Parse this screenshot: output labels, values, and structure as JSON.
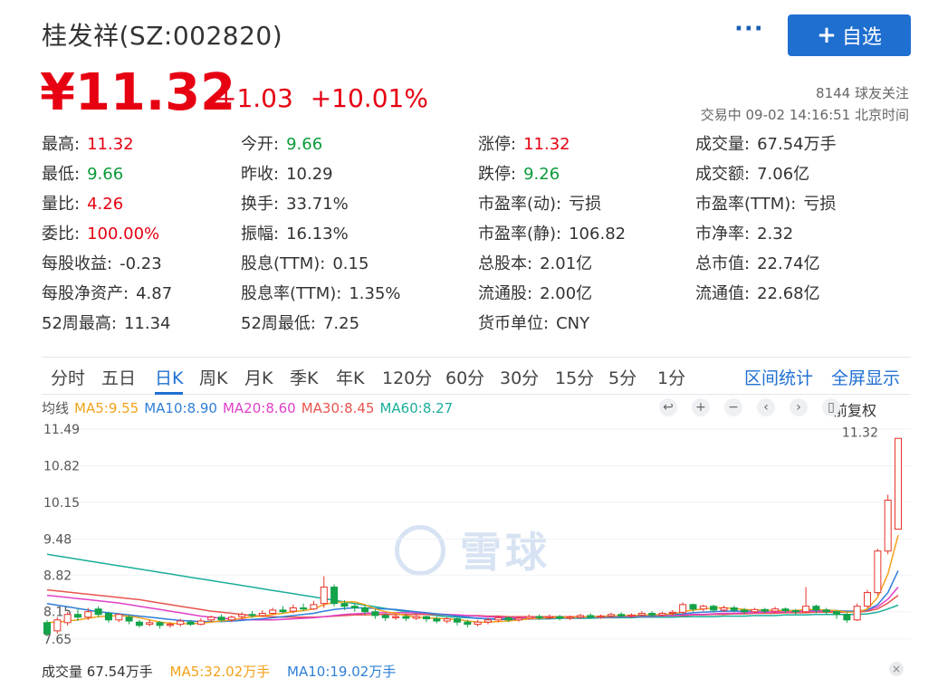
{
  "header": {
    "title": "桂发祥(SZ:002820)",
    "more_label": "···",
    "add_label": "自选",
    "add_plus": "+"
  },
  "quote": {
    "price": "¥11.32",
    "change": "+1.03",
    "change_pct": "+10.01%",
    "followers": "8144 球友关注",
    "trade_time": "交易中 09-02 14:16:51 北京时间"
  },
  "stats": [
    {
      "label": "最高:",
      "value": "11.32",
      "color": "red"
    },
    {
      "label": "今开:",
      "value": "9.66",
      "color": "green"
    },
    {
      "label": "涨停:",
      "value": "11.32",
      "color": "red"
    },
    {
      "label": "成交量:",
      "value": "67.54万手",
      "color": ""
    },
    {
      "label": "最低:",
      "value": "9.66",
      "color": "green"
    },
    {
      "label": "昨收:",
      "value": "10.29",
      "color": ""
    },
    {
      "label": "跌停:",
      "value": "9.26",
      "color": "green"
    },
    {
      "label": "成交额:",
      "value": "7.06亿",
      "color": ""
    },
    {
      "label": "量比:",
      "value": "4.26",
      "color": "red"
    },
    {
      "label": "换手:",
      "value": "33.71%",
      "color": ""
    },
    {
      "label": "市盈率(动):",
      "value": "亏损",
      "color": ""
    },
    {
      "label": "市盈率(TTM):",
      "value": "亏损",
      "color": ""
    },
    {
      "label": "委比:",
      "value": "100.00%",
      "color": "red"
    },
    {
      "label": "振幅:",
      "value": "16.13%",
      "color": ""
    },
    {
      "label": "市盈率(静):",
      "value": "106.82",
      "color": ""
    },
    {
      "label": "市净率:",
      "value": "2.32",
      "color": ""
    },
    {
      "label": "每股收益:",
      "value": "-0.23",
      "color": ""
    },
    {
      "label": "股息(TTM):",
      "value": "0.15",
      "color": ""
    },
    {
      "label": "总股本:",
      "value": "2.01亿",
      "color": ""
    },
    {
      "label": "总市值:",
      "value": "22.74亿",
      "color": ""
    },
    {
      "label": "每股净资产:",
      "value": "4.87",
      "color": ""
    },
    {
      "label": "股息率(TTM):",
      "value": "1.35%",
      "color": ""
    },
    {
      "label": "流通股:",
      "value": "2.00亿",
      "color": ""
    },
    {
      "label": "流通值:",
      "value": "22.68亿",
      "color": ""
    },
    {
      "label": "52周最高:",
      "value": "11.34",
      "color": ""
    },
    {
      "label": "52周最低:",
      "value": "7.25",
      "color": ""
    },
    {
      "label": "货币单位:",
      "value": "CNY",
      "color": ""
    }
  ],
  "tabs": [
    "分时",
    "五日",
    "日K",
    "周K",
    "月K",
    "季K",
    "年K",
    "120分",
    "60分",
    "30分",
    "15分",
    "5分",
    "1分"
  ],
  "active_tab": "日K",
  "tab_links": [
    "区间统计",
    "全屏显示"
  ],
  "ma": {
    "label": "均线",
    "items": [
      {
        "text": "MA5:9.55",
        "color": "#f2a21b"
      },
      {
        "text": "MA10:8.90",
        "color": "#2f7fd8"
      },
      {
        "text": "MA20:8.60",
        "color": "#e040c8"
      },
      {
        "text": "MA30:8.45",
        "color": "#e8544e"
      },
      {
        "text": "MA60:8.27",
        "color": "#1aae9a"
      }
    ]
  },
  "controls": {
    "buttons": [
      "↩",
      "+",
      "−",
      "‹",
      "›",
      "▯"
    ],
    "adjust_label": "前复权"
  },
  "chart_data": {
    "type": "candlestick",
    "y_ticks": [
      "11.49",
      "10.82",
      "10.15",
      "9.48",
      "8.82",
      "8.15",
      "7.65"
    ],
    "ylim": [
      7.45,
      11.49
    ],
    "last_price_label": "11.32",
    "candles": [
      [
        7.95,
        7.75,
        8.0,
        7.7
      ],
      [
        7.8,
        8.0,
        8.05,
        7.75
      ],
      [
        7.95,
        8.1,
        8.15,
        7.9
      ],
      [
        8.1,
        8.05,
        8.2,
        7.98
      ],
      [
        8.05,
        8.15,
        8.22,
        8.0
      ],
      [
        8.2,
        8.1,
        8.25,
        8.05
      ],
      [
        8.12,
        8.0,
        8.15,
        7.95
      ],
      [
        8.0,
        8.1,
        8.12,
        7.96
      ],
      [
        8.05,
        7.98,
        8.08,
        7.92
      ],
      [
        7.96,
        7.9,
        8.0,
        7.86
      ],
      [
        7.92,
        7.95,
        8.0,
        7.88
      ],
      [
        7.95,
        7.9,
        7.98,
        7.84
      ],
      [
        7.9,
        7.92,
        7.96,
        7.86
      ],
      [
        7.92,
        7.98,
        8.02,
        7.88
      ],
      [
        7.96,
        7.92,
        8.0,
        7.89
      ],
      [
        7.92,
        7.98,
        8.03,
        7.9
      ],
      [
        8.0,
        8.05,
        8.08,
        7.96
      ],
      [
        8.05,
        8.0,
        8.1,
        7.97
      ],
      [
        8.0,
        8.05,
        8.08,
        7.96
      ],
      [
        8.06,
        8.1,
        8.14,
        8.02
      ],
      [
        8.1,
        8.08,
        8.16,
        8.04
      ],
      [
        8.08,
        8.12,
        8.18,
        8.05
      ],
      [
        8.12,
        8.18,
        8.22,
        8.1
      ],
      [
        8.18,
        8.15,
        8.25,
        8.12
      ],
      [
        8.16,
        8.22,
        8.28,
        8.12
      ],
      [
        8.22,
        8.2,
        8.3,
        8.16
      ],
      [
        8.2,
        8.28,
        8.35,
        8.18
      ],
      [
        8.3,
        8.6,
        8.8,
        8.22
      ],
      [
        8.6,
        8.3,
        8.65,
        8.25
      ],
      [
        8.3,
        8.25,
        8.36,
        8.18
      ],
      [
        8.25,
        8.22,
        8.3,
        8.15
      ],
      [
        8.22,
        8.15,
        8.28,
        8.1
      ],
      [
        8.15,
        8.08,
        8.2,
        8.02
      ],
      [
        8.08,
        8.04,
        8.12,
        7.98
      ],
      [
        8.04,
        8.06,
        8.1,
        8.0
      ],
      [
        8.06,
        8.03,
        8.1,
        7.98
      ],
      [
        8.03,
        8.06,
        8.09,
        8.0
      ],
      [
        8.06,
        8.02,
        8.08,
        7.96
      ],
      [
        8.02,
        7.98,
        8.06,
        7.94
      ],
      [
        7.98,
        8.02,
        8.05,
        7.94
      ],
      [
        8.02,
        7.96,
        8.04,
        7.9
      ],
      [
        7.96,
        7.92,
        8.0,
        7.86
      ],
      [
        7.92,
        7.96,
        8.0,
        7.88
      ],
      [
        7.96,
        8.0,
        8.04,
        7.92
      ],
      [
        8.0,
        8.04,
        8.08,
        7.96
      ],
      [
        8.04,
        8.0,
        8.06,
        7.96
      ],
      [
        8.0,
        8.03,
        8.06,
        7.97
      ],
      [
        8.03,
        8.06,
        8.1,
        8.0
      ],
      [
        8.06,
        8.04,
        8.1,
        8.0
      ],
      [
        8.04,
        8.06,
        8.1,
        8.01
      ],
      [
        8.06,
        8.03,
        8.09,
        7.99
      ],
      [
        8.03,
        8.05,
        8.08,
        8.0
      ],
      [
        8.05,
        8.08,
        8.11,
        8.02
      ],
      [
        8.08,
        8.05,
        8.12,
        8.02
      ],
      [
        8.05,
        8.07,
        8.1,
        8.02
      ],
      [
        8.07,
        8.1,
        8.13,
        8.04
      ],
      [
        8.1,
        8.07,
        8.14,
        8.04
      ],
      [
        8.07,
        8.09,
        8.12,
        8.04
      ],
      [
        8.09,
        8.12,
        8.16,
        8.06
      ],
      [
        8.12,
        8.09,
        8.16,
        8.05
      ],
      [
        8.09,
        8.12,
        8.15,
        8.06
      ],
      [
        8.12,
        8.14,
        8.18,
        8.08
      ],
      [
        8.14,
        8.28,
        8.32,
        8.1
      ],
      [
        8.28,
        8.2,
        8.3,
        8.15
      ],
      [
        8.2,
        8.25,
        8.28,
        8.16
      ],
      [
        8.25,
        8.18,
        8.28,
        8.14
      ],
      [
        8.18,
        8.22,
        8.26,
        8.15
      ],
      [
        8.22,
        8.18,
        8.26,
        8.14
      ],
      [
        8.18,
        8.15,
        8.22,
        8.1
      ],
      [
        8.15,
        8.19,
        8.22,
        8.12
      ],
      [
        8.19,
        8.16,
        8.22,
        8.12
      ],
      [
        8.16,
        8.2,
        8.24,
        8.13
      ],
      [
        8.2,
        8.17,
        8.23,
        8.13
      ],
      [
        8.17,
        8.15,
        8.2,
        8.1
      ],
      [
        8.15,
        8.25,
        8.6,
        8.12
      ],
      [
        8.25,
        8.18,
        8.28,
        8.12
      ],
      [
        8.18,
        8.15,
        8.22,
        8.1
      ],
      [
        8.15,
        8.1,
        8.18,
        8.02
      ],
      [
        8.1,
        8.0,
        8.14,
        7.95
      ],
      [
        8.0,
        8.25,
        8.3,
        7.98
      ],
      [
        8.25,
        8.5,
        8.55,
        8.22
      ],
      [
        8.5,
        9.26,
        9.3,
        8.45
      ],
      [
        9.26,
        10.19,
        10.29,
        9.2
      ],
      [
        9.66,
        11.32,
        11.32,
        9.66
      ]
    ],
    "ma5": [
      7.95,
      7.96,
      7.98,
      8.0,
      8.03,
      8.06,
      8.07,
      8.08,
      8.07,
      8.04,
      8.0,
      7.96,
      7.94,
      7.93,
      7.93,
      7.94,
      7.96,
      7.98,
      8.0,
      8.03,
      8.06,
      8.07,
      8.1,
      8.12,
      8.15,
      8.17,
      8.2,
      8.28,
      8.32,
      8.33,
      8.33,
      8.28,
      8.2,
      8.15,
      8.12,
      8.08,
      8.05,
      8.04,
      8.03,
      8.02,
      8.01,
      7.98,
      7.96,
      7.96,
      7.97,
      7.98,
      8.0,
      8.02,
      8.03,
      8.04,
      8.04,
      8.05,
      8.05,
      8.06,
      8.07,
      8.07,
      8.08,
      8.08,
      8.09,
      8.09,
      8.1,
      8.11,
      8.15,
      8.18,
      8.2,
      8.22,
      8.22,
      8.21,
      8.19,
      8.18,
      8.18,
      8.17,
      8.17,
      8.17,
      8.19,
      8.19,
      8.18,
      8.17,
      8.14,
      8.14,
      8.2,
      8.41,
      8.84,
      9.55
    ],
    "ma10": [
      8.3,
      8.27,
      8.24,
      8.21,
      8.18,
      8.15,
      8.13,
      8.11,
      8.09,
      8.07,
      8.05,
      8.03,
      8.01,
      7.99,
      7.98,
      7.97,
      7.97,
      7.97,
      7.98,
      7.99,
      8.01,
      8.02,
      8.04,
      8.06,
      8.08,
      8.1,
      8.12,
      8.16,
      8.19,
      8.21,
      8.22,
      8.22,
      8.21,
      8.2,
      8.19,
      8.17,
      8.15,
      8.13,
      8.11,
      8.09,
      8.07,
      8.05,
      8.03,
      8.02,
      8.01,
      8.01,
      8.01,
      8.02,
      8.02,
      8.03,
      8.03,
      8.04,
      8.04,
      8.05,
      8.06,
      8.06,
      8.07,
      8.07,
      8.08,
      8.08,
      8.09,
      8.1,
      8.11,
      8.13,
      8.14,
      8.15,
      8.16,
      8.16,
      8.16,
      8.16,
      8.17,
      8.17,
      8.17,
      8.17,
      8.18,
      8.18,
      8.18,
      8.17,
      8.16,
      8.16,
      8.18,
      8.28,
      8.5,
      8.9
    ],
    "ma20": [
      8.45,
      8.43,
      8.41,
      8.39,
      8.37,
      8.35,
      8.33,
      8.31,
      8.28,
      8.25,
      8.22,
      8.19,
      8.16,
      8.13,
      8.1,
      8.07,
      8.05,
      8.03,
      8.02,
      8.01,
      8.0,
      8.0,
      8.0,
      8.01,
      8.02,
      8.03,
      8.04,
      8.06,
      8.08,
      8.1,
      8.11,
      8.12,
      8.13,
      8.13,
      8.13,
      8.13,
      8.13,
      8.12,
      8.11,
      8.1,
      8.09,
      8.08,
      8.07,
      8.06,
      8.05,
      8.04,
      8.04,
      8.04,
      8.04,
      8.04,
      8.04,
      8.04,
      8.04,
      8.05,
      8.05,
      8.05,
      8.06,
      8.06,
      8.07,
      8.07,
      8.08,
      8.08,
      8.09,
      8.1,
      8.1,
      8.11,
      8.12,
      8.12,
      8.13,
      8.13,
      8.14,
      8.14,
      8.15,
      8.15,
      8.16,
      8.16,
      8.16,
      8.16,
      8.16,
      8.16,
      8.18,
      8.24,
      8.38,
      8.6
    ],
    "ma30": [
      8.55,
      8.53,
      8.51,
      8.49,
      8.47,
      8.45,
      8.43,
      8.41,
      8.39,
      8.37,
      8.34,
      8.31,
      8.28,
      8.25,
      8.22,
      8.19,
      8.16,
      8.14,
      8.12,
      8.1,
      8.08,
      8.07,
      8.06,
      8.05,
      8.05,
      8.05,
      8.05,
      8.06,
      8.07,
      8.08,
      8.09,
      8.09,
      8.1,
      8.1,
      8.1,
      8.1,
      8.1,
      8.1,
      8.1,
      8.09,
      8.09,
      8.08,
      8.08,
      8.07,
      8.07,
      8.06,
      8.06,
      8.06,
      8.06,
      8.06,
      8.06,
      8.06,
      8.06,
      8.06,
      8.06,
      8.06,
      8.06,
      8.07,
      8.07,
      8.07,
      8.08,
      8.08,
      8.08,
      8.09,
      8.09,
      8.1,
      8.1,
      8.11,
      8.11,
      8.12,
      8.12,
      8.12,
      8.13,
      8.13,
      8.13,
      8.14,
      8.14,
      8.14,
      8.14,
      8.14,
      8.16,
      8.2,
      8.31,
      8.45
    ],
    "ma60": [
      9.2,
      9.17,
      9.14,
      9.11,
      9.08,
      9.05,
      9.02,
      8.99,
      8.96,
      8.93,
      8.9,
      8.87,
      8.84,
      8.81,
      8.78,
      8.75,
      8.72,
      8.69,
      8.66,
      8.63,
      8.6,
      8.57,
      8.54,
      8.51,
      8.48,
      8.45,
      8.42,
      8.39,
      8.36,
      8.33,
      8.3,
      8.27,
      8.24,
      8.21,
      8.18,
      8.15,
      8.12,
      8.1,
      8.08,
      8.06,
      8.05,
      8.04,
      8.03,
      8.02,
      8.02,
      8.02,
      8.02,
      8.02,
      8.02,
      8.02,
      8.03,
      8.03,
      8.03,
      8.03,
      8.04,
      8.04,
      8.04,
      8.04,
      8.05,
      8.05,
      8.05,
      8.05,
      8.06,
      8.06,
      8.06,
      8.06,
      8.07,
      8.07,
      8.07,
      8.08,
      8.08,
      8.08,
      8.09,
      8.09,
      8.09,
      8.1,
      8.1,
      8.1,
      8.1,
      8.1,
      8.11,
      8.14,
      8.2,
      8.27
    ]
  },
  "volume": {
    "label": "成交量 67.54万手",
    "ma5": "MA5:32.02万手",
    "ma10": "MA10:19.02万手",
    "close": "×"
  },
  "watermark": "雪球"
}
